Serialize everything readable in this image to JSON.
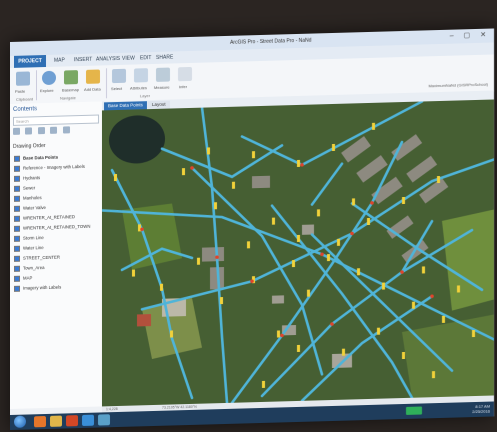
{
  "window": {
    "title": "ArcGIS Pro - Street Data Pro - NaNd",
    "controls": "–  ▢  ✕",
    "signin": "MaximumNaNd (GISRProSchool)"
  },
  "ribbon_tabs": {
    "project": "PROJECT",
    "map": "MAP",
    "insert": "INSERT",
    "analysis": "ANALYSIS",
    "view": "VIEW",
    "edit": "EDIT",
    "share": "SHARE"
  },
  "ribbon": {
    "btn_paste": "Paste",
    "btn_explore": "Explore",
    "btn_basemap": "Basemap",
    "btn_add_data": "Add Data",
    "btn_select": "Select",
    "btn_attributes": "Attributes",
    "btn_measure": "Measure",
    "btn_infer": "Infer",
    "btn_labeling": "Labeling",
    "group_clipboard": "Clipboard",
    "group_navigate": "Navigate",
    "group_layer": "Layer"
  },
  "contents": {
    "title": "Contents",
    "search_placeholder": "Search",
    "drawing_order": "Drawing Order",
    "layers": [
      {
        "label": "Base Data Points",
        "checked": true,
        "map": true
      },
      {
        "label": "Reference - Imagery with Labels",
        "checked": true
      },
      {
        "label": "Hydrants",
        "checked": true
      },
      {
        "label": "Sewer",
        "checked": true
      },
      {
        "label": "Manholes",
        "checked": true
      },
      {
        "label": "Water Valve",
        "checked": true
      },
      {
        "label": "WRENTER_At_RETAINED",
        "checked": true
      },
      {
        "label": "WRENTER_At_RETAINED_TOWN",
        "checked": true
      },
      {
        "label": "Storm Line",
        "checked": true
      },
      {
        "label": "Water Line",
        "checked": true
      },
      {
        "label": "STREET_CENTER",
        "checked": true
      },
      {
        "label": "Town_Area",
        "checked": true
      },
      {
        "label": "MAP",
        "checked": true
      },
      {
        "label": "Imagery with Labels",
        "checked": true
      }
    ]
  },
  "view_tabs": {
    "active": "Base Data Points",
    "other": "Layout"
  },
  "status": {
    "scale": "1:4,228",
    "coords": "73.2105°W 42.1180°N"
  },
  "taskbar": {
    "time": "8:17 AM",
    "date": "2/25/2016"
  },
  "colors": {
    "accent": "#2f6fb4",
    "water_line": "#4fb4d8",
    "hydrant": "#f2d23a",
    "valve": "#e0442b",
    "vegetation": "#3d5a2c"
  }
}
